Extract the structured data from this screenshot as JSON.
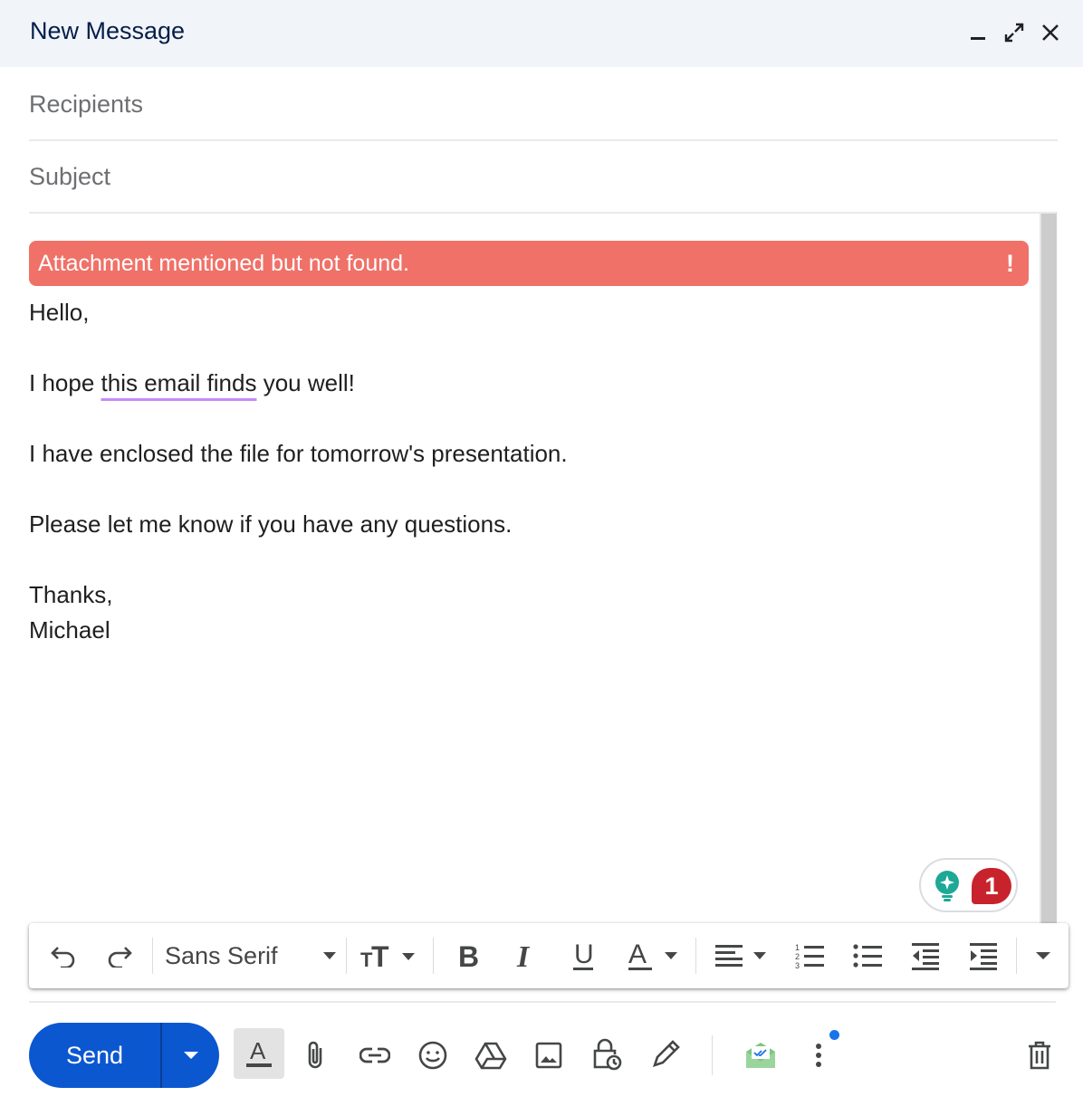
{
  "window": {
    "title": "New Message"
  },
  "fields": {
    "recipients_placeholder": "Recipients",
    "subject_placeholder": "Subject"
  },
  "alert": {
    "message": "Attachment mentioned but not found.",
    "indicator": "!",
    "color": "#f07168"
  },
  "body": {
    "greeting": "Hello,",
    "line1_pre": "I hope ",
    "line1_flagged": "this email finds",
    "line1_post": " you well!",
    "line2": "I have enclosed the file for tomorrow's presentation.",
    "line3": "Please let me know if you have any questions.",
    "closing": "Thanks,",
    "signature": "Michael"
  },
  "assistant": {
    "icon": "lightbulb-sparkle-icon",
    "count": "1"
  },
  "formatting": {
    "font": "Sans Serif",
    "tools": [
      "undo-icon",
      "redo-icon",
      "text-size-icon",
      "bold-icon",
      "italic-icon",
      "underline-icon",
      "text-color-icon",
      "align-icon",
      "numbered-list-icon",
      "bulleted-list-icon",
      "indent-less-icon",
      "indent-more-icon",
      "more-formatting-icon"
    ]
  },
  "actions": {
    "send_label": "Send",
    "brand_color": "#0b57d0",
    "tools": [
      "formatting-options-icon",
      "attach-icon",
      "link-icon",
      "emoji-icon",
      "drive-icon",
      "photo-icon",
      "confidential-mode-icon",
      "signature-icon",
      "mailtrack-icon",
      "more-options-icon",
      "delete-icon"
    ]
  }
}
